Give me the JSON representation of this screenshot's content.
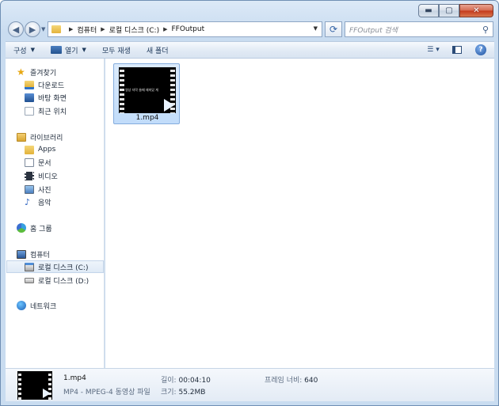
{
  "window": {
    "caption": {
      "minimize": "▬",
      "maximize": "▢",
      "close": "✕"
    }
  },
  "address": {
    "crumbs": [
      "컴퓨터",
      "로컬 디스크 (C:)",
      "FFOutput"
    ]
  },
  "search": {
    "placeholder": "FFOutput 검색"
  },
  "toolbar": {
    "organize": "구성",
    "open": "열기",
    "play_all": "모두 재생",
    "new_folder": "새 폴더"
  },
  "nav": {
    "favorites": {
      "label": "즐겨찾기",
      "items": [
        "다운로드",
        "바탕 화면",
        "최근 위치"
      ]
    },
    "libraries": {
      "label": "라이브러리",
      "items": [
        "Apps",
        "문서",
        "비디오",
        "사진",
        "음악"
      ]
    },
    "homegroup": {
      "label": "홈 그룹"
    },
    "computer": {
      "label": "컴퓨터",
      "items": [
        "로컬 디스크 (C:)",
        "로컬 디스크 (D:)"
      ]
    },
    "network": {
      "label": "네트워크"
    }
  },
  "files": [
    {
      "name": "1.mp4",
      "subtitle": "영상 자막 쓸때 재미있 게"
    }
  ],
  "details": {
    "name": "1.mp4",
    "type": "MP4 - MPEG-4 동영상 파일",
    "length_label": "길이:",
    "length_value": "00:04:10",
    "size_label": "크기:",
    "size_value": "55.2MB",
    "frame_width_label": "프레임 너비:",
    "frame_width_value": "640"
  }
}
